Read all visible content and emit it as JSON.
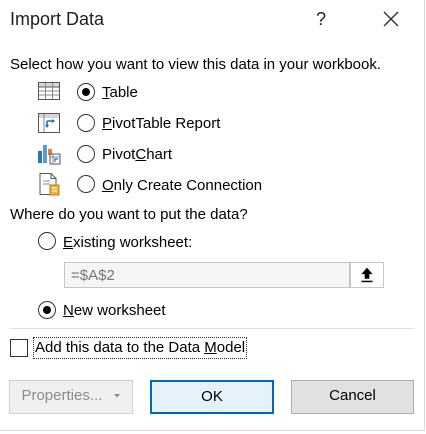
{
  "dialog": {
    "title": "Import Data",
    "help_label": "?",
    "close_icon": "close-icon"
  },
  "view_section": {
    "prompt": "Select how you want to view this data in your workbook.",
    "options": [
      {
        "icon": "table-icon",
        "label_u": "T",
        "label_rest": "able",
        "selected": true
      },
      {
        "icon": "pivottable-icon",
        "label_u": "P",
        "label_rest": "ivotTable Report",
        "selected": false
      },
      {
        "icon": "pivotchart-icon",
        "label_pre": "Pivot",
        "label_u": "C",
        "label_rest": "hart",
        "selected": false
      },
      {
        "icon": "connection-icon",
        "label_u": "O",
        "label_rest": "nly Create Connection",
        "selected": false
      }
    ]
  },
  "location_section": {
    "prompt": "Where do you want to put the data?",
    "existing": {
      "label_u": "E",
      "label_rest": "xisting worksheet:",
      "selected": false
    },
    "reference_value": "=$A$2",
    "new": {
      "label_u": "N",
      "label_rest": "ew worksheet",
      "selected": true
    }
  },
  "data_model": {
    "label_pre": "Add this data to the Data ",
    "label_u": "M",
    "label_rest": "odel",
    "checked": false
  },
  "buttons": {
    "properties": "Properties...",
    "ok": "OK",
    "cancel": "Cancel"
  }
}
